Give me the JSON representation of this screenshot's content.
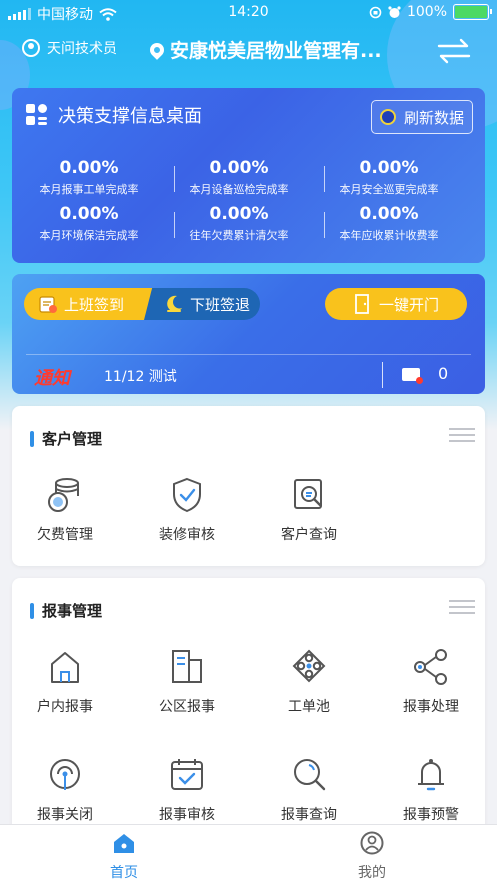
{
  "status_bar": {
    "carrier": "中国移动",
    "time": "14:20",
    "battery": "100%"
  },
  "header": {
    "user_name": "天问技术员",
    "location": "安康悦美居物业管理有..."
  },
  "decision_panel": {
    "title": "决策支撑信息桌面",
    "refresh_label": "刷新数据",
    "stats": [
      {
        "value": "0.00%",
        "label": "本月报事工单完成率"
      },
      {
        "value": "0.00%",
        "label": "本月设备巡检完成率"
      },
      {
        "value": "0.00%",
        "label": "本月安全巡更完成率"
      },
      {
        "value": "0.00%",
        "label": "本月环境保洁完成率"
      },
      {
        "value": "0.00%",
        "label": "往年欠费累计清欠率"
      },
      {
        "value": "0.00%",
        "label": "本年应收累计收费率"
      }
    ]
  },
  "attendance": {
    "sign_in_label": "上班签到",
    "sign_out_label": "下班签退",
    "open_door_label": "一键开门",
    "notice_logo": "通知",
    "notice_text": "11/12 测试",
    "message_count": "0"
  },
  "customer_module": {
    "title": "客户管理",
    "items": [
      {
        "label": "欠费管理",
        "icon": "coins-stack-icon"
      },
      {
        "label": "装修审核",
        "icon": "shield-check-icon"
      },
      {
        "label": "客户查询",
        "icon": "search-doc-icon"
      }
    ]
  },
  "report_module": {
    "title": "报事管理",
    "items": [
      {
        "label": "户内报事",
        "icon": "house-icon"
      },
      {
        "label": "公区报事",
        "icon": "building-icon"
      },
      {
        "label": "工单池",
        "icon": "network-icon"
      },
      {
        "label": "报事处理",
        "icon": "share-icon"
      },
      {
        "label": "报事关闭",
        "icon": "signal-pin-icon"
      },
      {
        "label": "报事审核",
        "icon": "calendar-check-icon"
      },
      {
        "label": "报事查询",
        "icon": "magnifier-icon"
      },
      {
        "label": "报事预警",
        "icon": "bell-icon"
      }
    ]
  },
  "tab_bar": {
    "home_label": "首页",
    "mine_label": "我的"
  },
  "colors": {
    "accent": "#2f8fe6",
    "yellow": "#f9c21c",
    "panel_blue": "#3b63e6"
  }
}
